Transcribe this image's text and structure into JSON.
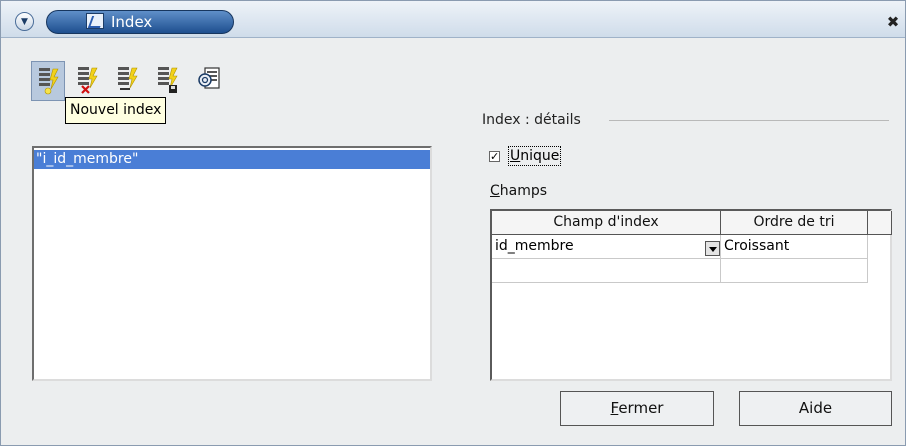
{
  "window": {
    "title": "Index",
    "menu_icon": "chevron-down-icon",
    "close_label": "✖",
    "close_icon": "close-icon"
  },
  "toolbar": {
    "buttons": [
      {
        "name": "new-index",
        "icon": "new-index-icon",
        "active": true
      },
      {
        "name": "delete-index",
        "icon": "delete-index-icon"
      },
      {
        "name": "rename-index",
        "icon": "rename-index-icon"
      },
      {
        "name": "save-index",
        "icon": "save-index-icon"
      },
      {
        "name": "reset-index",
        "icon": "reset-index-icon"
      }
    ],
    "tooltip": "Nouvel index"
  },
  "index_list": {
    "items": [
      {
        "label": "\"i_id_membre\"",
        "selected": true
      }
    ]
  },
  "details": {
    "group_title": "Index : détails",
    "unique_checked": true,
    "unique_mark": "✓",
    "unique_label": {
      "u": "U",
      "rest": "nique"
    },
    "fields_label": {
      "u": "C",
      "rest": "hamps"
    },
    "grid": {
      "headers": [
        "Champ d'index",
        "Ordre de tri"
      ],
      "rows": [
        {
          "field": "id_membre",
          "order": "Croissant"
        },
        {
          "field": "",
          "order": ""
        }
      ]
    }
  },
  "buttons": {
    "close": {
      "u": "F",
      "rest": "ermer"
    },
    "help": "Aide"
  },
  "colors": {
    "selection": "#4a7ed6",
    "tooltip_bg": "#ffffe1",
    "title_pill": "#2e5f9f"
  }
}
